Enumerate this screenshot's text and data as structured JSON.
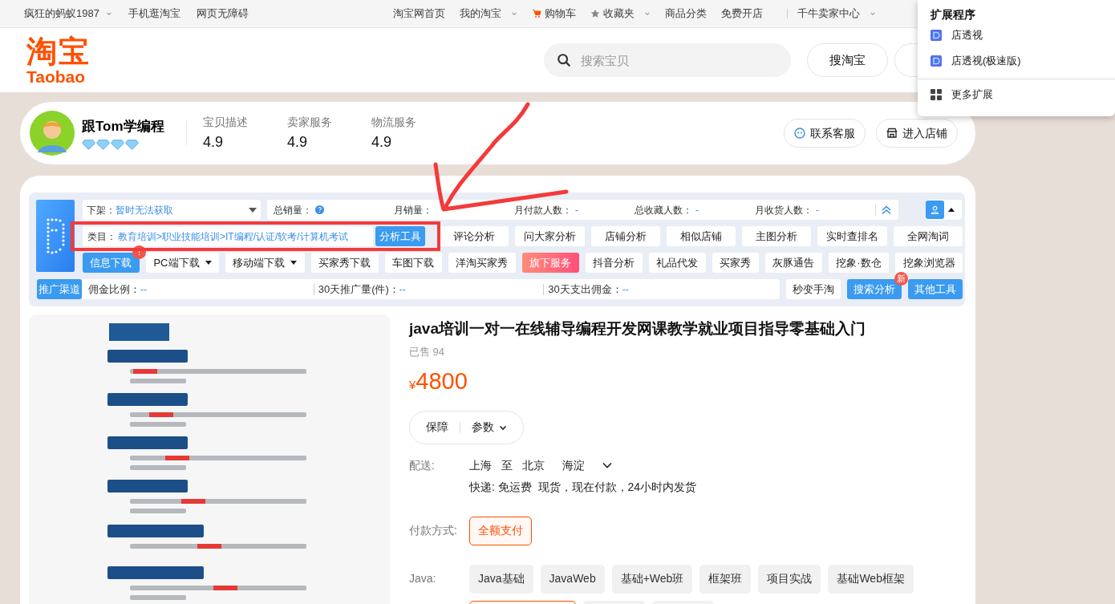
{
  "top_bar": {
    "left": [
      {
        "label": "疯狂的蚂蚁1987",
        "dropdown": true
      },
      {
        "label": "手机逛淘宝",
        "dropdown": false
      },
      {
        "label": "网页无障碍",
        "dropdown": false
      }
    ],
    "right_groups": [
      [
        {
          "label": "淘宝网首页",
          "kind": "link",
          "dropdown": false
        },
        {
          "label": "我的淘宝",
          "kind": "link",
          "dropdown": true
        },
        {
          "label": "购物车",
          "kind": "cart",
          "dropdown": false
        },
        {
          "label": "收藏夹",
          "kind": "star",
          "dropdown": true
        },
        {
          "label": "商品分类",
          "kind": "link",
          "dropdown": false
        },
        {
          "label": "免费开店",
          "kind": "link",
          "dropdown": false
        }
      ],
      [
        {
          "label": "千牛卖家中心",
          "kind": "link",
          "dropdown": true
        }
      ]
    ]
  },
  "header": {
    "logo": {
      "mark": "淘宝",
      "wordmark": "Taobao"
    },
    "search": {
      "placeholder": "搜索宝贝"
    },
    "buttons": [
      {
        "label": "搜淘宝",
        "covered": false
      },
      {
        "covered": true
      }
    ]
  },
  "extensions_popup": {
    "title": "扩展程序",
    "items": [
      {
        "label": "店透视"
      },
      {
        "label": "店透视(极速版)"
      }
    ],
    "more": "更多扩展"
  },
  "shop": {
    "name": "跟Tom学编程",
    "stars": 4,
    "ratings": [
      {
        "label": "宝贝描述",
        "value": "4.9"
      },
      {
        "label": "卖家服务",
        "value": "4.9"
      },
      {
        "label": "物流服务",
        "value": "4.9"
      }
    ],
    "buttons": [
      {
        "label": "联系客服",
        "kind": "chat"
      },
      {
        "label": "进入店铺",
        "kind": "store"
      }
    ]
  },
  "plugin": {
    "delist": {
      "label": "下架：",
      "value": "暂时无法获取"
    },
    "stats": [
      {
        "label": "总销量：",
        "kind": "help"
      },
      {
        "label": "月销量：",
        "kind": "text"
      },
      {
        "label": "月付款人数：",
        "kind": "text",
        "value": "-"
      },
      {
        "label": "总收藏人数：",
        "kind": "text",
        "value": "-"
      },
      {
        "label": "月收货人数：",
        "kind": "text",
        "value": "-"
      }
    ],
    "category": {
      "label": "类目：",
      "path": "教育培训>职业技能培训>IT编程/认证/软考/计算机考试"
    },
    "analysis_button": "分析工具",
    "tools": [
      "评论分析",
      "问大家分析",
      "店铺分析",
      "相似店铺",
      "主图分析",
      "实时查排名",
      "全网淘词"
    ],
    "actions": [
      {
        "label": "信息下载",
        "kind": "primary",
        "badge": "!"
      },
      {
        "label": "PC端下载",
        "kind": "dropdown"
      },
      {
        "label": "移动端下载",
        "kind": "dropdown"
      },
      {
        "label": "买家秀下载",
        "kind": "plain"
      },
      {
        "label": "车图下载",
        "kind": "plain"
      },
      {
        "label": "洋淘买家秀",
        "kind": "plain"
      },
      {
        "label": "旗下服务",
        "kind": "featured"
      },
      {
        "label": "抖音分析",
        "kind": "plain"
      },
      {
        "label": "礼品代发",
        "kind": "plain"
      },
      {
        "label": "买家秀",
        "kind": "plain"
      },
      {
        "label": "灰豚通告",
        "kind": "plain"
      },
      {
        "label": "挖象·数仓",
        "kind": "plain"
      },
      {
        "label": "挖象浏览器",
        "kind": "plain"
      }
    ],
    "channel": {
      "label": "推广渠道",
      "metrics": [
        {
          "label": "佣金比例：",
          "value": "--"
        },
        {
          "label": "30天推广量(件)：",
          "value": "--"
        },
        {
          "label": "30天支出佣金：",
          "value": "--"
        }
      ]
    },
    "bottom_buttons": [
      {
        "label": "秒变手淘",
        "kind": "plain"
      },
      {
        "label": "搜索分析",
        "kind": "primary",
        "badge": "新"
      },
      {
        "label": "其他工具",
        "kind": "primary"
      }
    ]
  },
  "product": {
    "title": "java培训一对一在线辅导编程开发网课教学就业项目指导零基础入门",
    "sold": "已售 94",
    "price": {
      "currency": "¥",
      "amount": "4800"
    },
    "tabs": [
      {
        "label": "保障",
        "dropdown": false
      },
      {
        "label": "参数",
        "dropdown": true
      }
    ],
    "delivery": {
      "label": "配送:",
      "from": "上海",
      "to_word": "至",
      "to": "北京",
      "district": "海淀",
      "detail": "快递: 免运费  现货，现在付款，24小时内发货"
    },
    "payment": {
      "label": "付款方式:",
      "options": [
        {
          "label": "全额支付",
          "selected": true
        }
      ]
    },
    "java": {
      "label": "Java:",
      "options": [
        {
          "label": "Java基础",
          "selected": false
        },
        {
          "label": "JavaWeb",
          "selected": false
        },
        {
          "label": "基础+Web班",
          "selected": false
        },
        {
          "label": "框架班",
          "selected": false
        },
        {
          "label": "项目实战",
          "selected": false
        },
        {
          "label": "基础Web框架",
          "selected": false
        }
      ],
      "partial_options": [
        {
          "selected": true
        },
        {
          "selected": false
        },
        {
          "selected": false
        }
      ]
    }
  },
  "annotations": {
    "highlight_box": true,
    "arrow": true
  }
}
